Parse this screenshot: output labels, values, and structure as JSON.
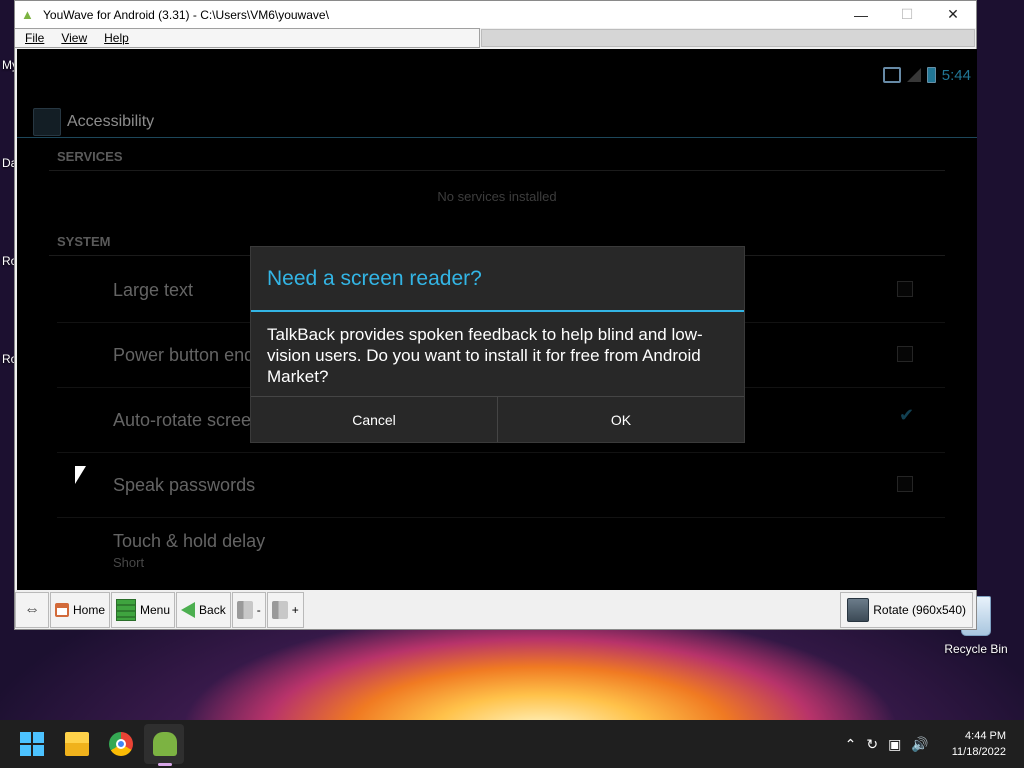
{
  "window": {
    "title": "YouWave for Android (3.31) - C:\\Users\\VM6\\youwave\\",
    "minimize": "—",
    "maximize": "☐",
    "close": "✕"
  },
  "menu": {
    "file": "File",
    "view": "View",
    "help": "Help"
  },
  "android": {
    "time": "5:44",
    "actionbar_title": "Accessibility",
    "services_header": "SERVICES",
    "no_services": "No services installed",
    "system_header": "SYSTEM",
    "prefs": [
      {
        "label": "Large text",
        "checked": false
      },
      {
        "label": "Power button ends call",
        "checked": false
      },
      {
        "label": "Auto-rotate screen",
        "checked": true
      },
      {
        "label": "Speak passwords",
        "checked": false
      },
      {
        "label": "Touch & hold delay",
        "summary": "Short"
      }
    ]
  },
  "dialog": {
    "title": "Need a screen reader?",
    "message": "TalkBack provides spoken feedback to help blind and low-vision users. Do you want to install it for free from Android Market?",
    "cancel": "Cancel",
    "ok": "OK"
  },
  "toolbar": {
    "home": "Home",
    "menu": "Menu",
    "back": "Back",
    "vol_down": "-",
    "vol_up": "+",
    "rotate": "Rotate (960x540)"
  },
  "desktop": {
    "recycle_bin": "Recycle Bin",
    "edge_labels": [
      "My",
      "Da",
      "Ro",
      "Ro"
    ]
  },
  "taskbar": {
    "time": "4:44 PM",
    "date": "11/18/2022"
  },
  "colors": {
    "android_accent": "#33b5e5",
    "dialog_bg": "#282828"
  }
}
